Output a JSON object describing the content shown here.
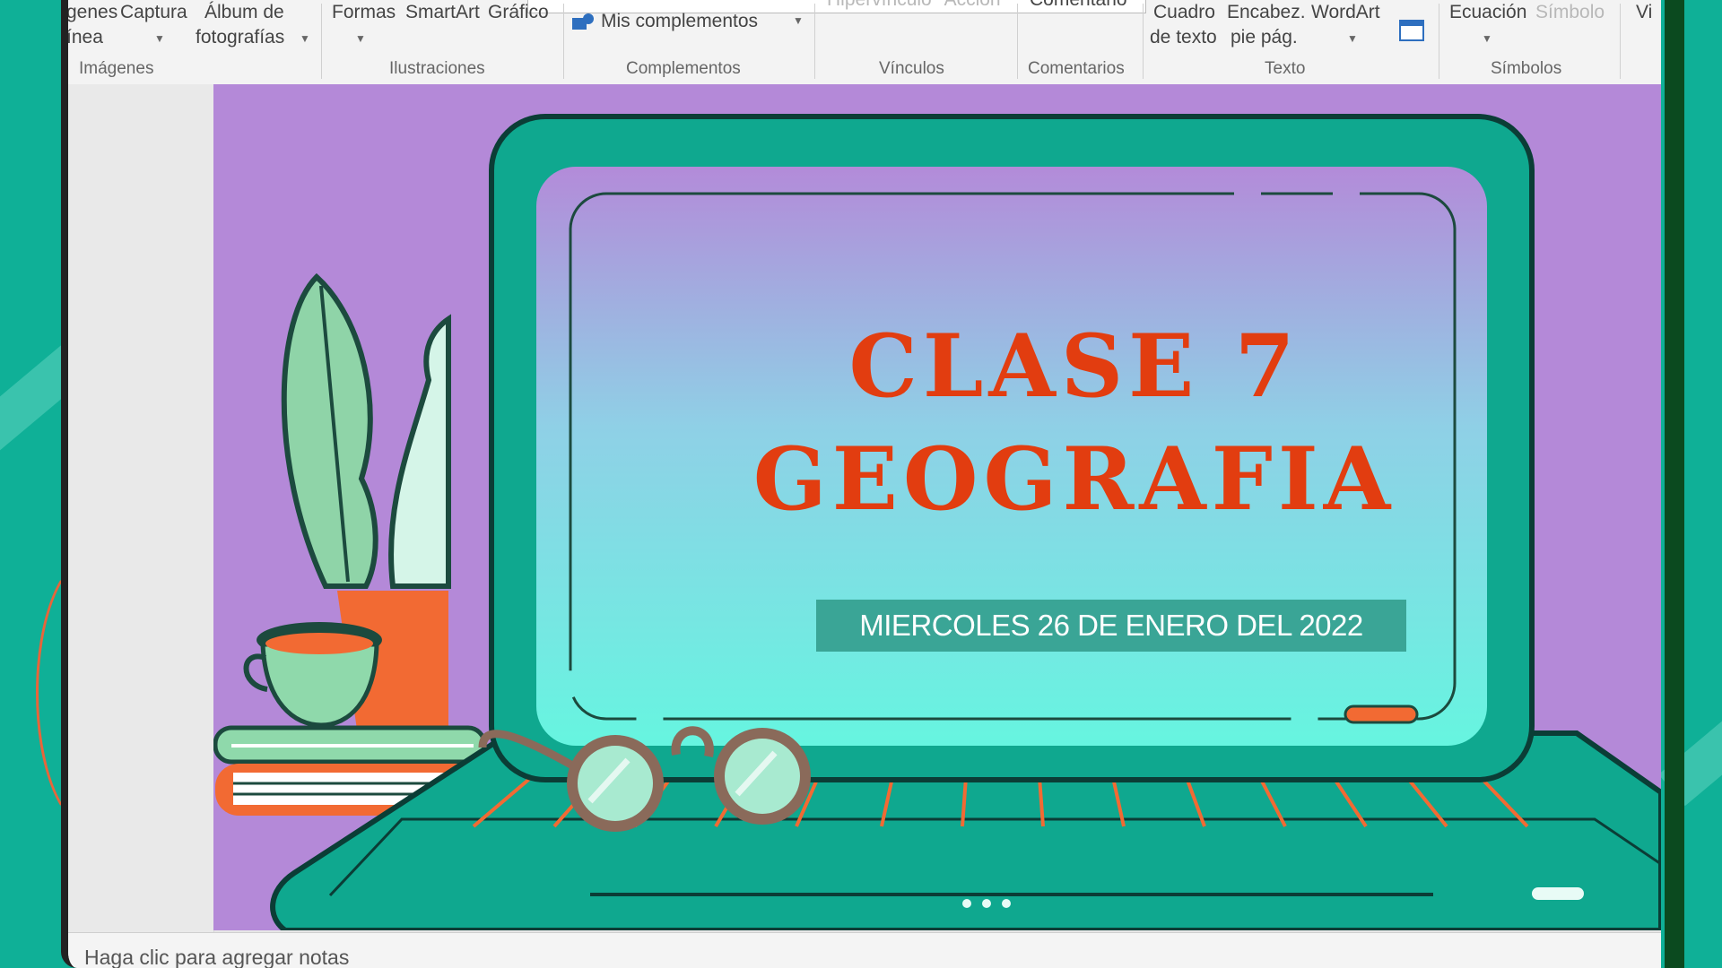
{
  "ribbon": {
    "buttons": {
      "imagenes_top": "genes",
      "imagenes_bottom": "ínea",
      "captura": "Captura",
      "album_top": "Álbum de",
      "album_bottom": "fotografías",
      "formas": "Formas",
      "smartart": "SmartArt",
      "grafico": "Gráfico",
      "mis_complementos": "Mis complementos",
      "hipervinculo": "Hipervínculo",
      "accion": "Acción",
      "comentario": "Comentario",
      "cuadro_top": "Cuadro",
      "cuadro_bottom": "de texto",
      "encabez_top": "Encabez.",
      "encabez_bottom": "pie pág.",
      "wordart": "WordArt",
      "ecuacion": "Ecuación",
      "simbolo": "Símbolo",
      "video": "Vi"
    },
    "groups": {
      "imagenes": "Imágenes",
      "ilustraciones": "Ilustraciones",
      "complementos": "Complementos",
      "vinculos": "Vínculos",
      "comentarios": "Comentarios",
      "texto": "Texto",
      "simbolos": "Símbolos"
    }
  },
  "slide": {
    "title_line1": "CLASE 7",
    "title_line2": "GEOGRAFIA",
    "date": "MIERCOLES 26 DE ENERO DEL 2022"
  },
  "notes_placeholder": "Haga clic para agregar notas",
  "colors": {
    "slide_background": "#b489d8",
    "laptop": "#0fa88f",
    "title": "#e23d10",
    "date_box": "#3aa596"
  }
}
